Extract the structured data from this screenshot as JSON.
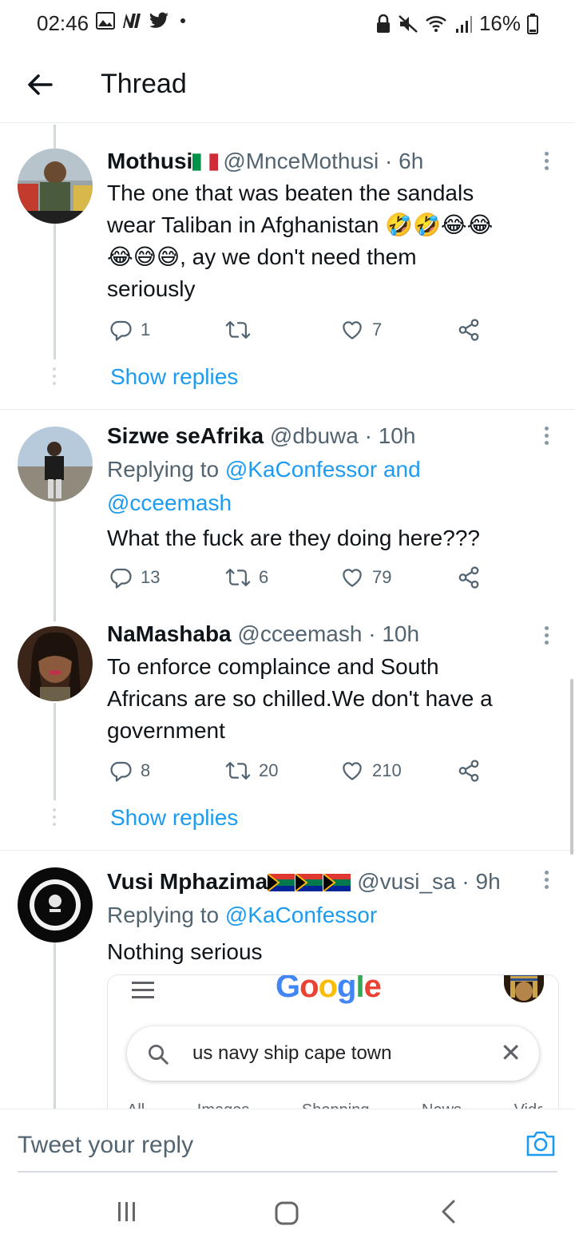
{
  "status_bar": {
    "time": "02:46",
    "battery": "16%"
  },
  "header": {
    "title": "Thread"
  },
  "tweets": [
    {
      "name": "Mothusi",
      "name_flag": "🇮🇹",
      "handle": "@MnceMothusi",
      "time": "· 6h",
      "text_line1": "The one that was beaten the sandals",
      "text_line2": "wear Taliban in Afghanistan 🤣🤣😂😂",
      "text_line3": "😂😅😅, ay we don't need them",
      "text_line4": "seriously",
      "replies": "1",
      "retweets": "",
      "likes": "7",
      "show_replies": "Show replies"
    },
    {
      "name": "Sizwe seAfrika",
      "handle": "@dbuwa",
      "time": "· 10h",
      "replying_prefix": "Replying to ",
      "replying_mention1": "@KaConfessor",
      "replying_and": " and",
      "replying_mention2": "@cceemash",
      "text": "What the fuck are they doing here???",
      "replies": "13",
      "retweets": "6",
      "likes": "79"
    },
    {
      "name": "NaMashaba",
      "handle": "@cceemash",
      "time": "· 10h",
      "text_line1": "To enforce complaince and South",
      "text_line2": "Africans are so chilled.We don't have a",
      "text_line3": "government",
      "replies": "8",
      "retweets": "20",
      "likes": "210",
      "show_replies": "Show replies"
    },
    {
      "name": "Vusi Mphazima",
      "name_flags": "🇿🇦🇿🇦🇿🇦",
      "handle": "@vusi_sa",
      "time": "· 9h",
      "replying_prefix": "Replying to ",
      "replying_mention1": "@KaConfessor",
      "text": "Nothing serious"
    }
  ],
  "embedded_image": {
    "logo": "Google",
    "search_query": "us navy ship cape town",
    "tabs": "All Images Shopping News Videos M"
  },
  "reply_bar": {
    "placeholder": "Tweet your reply"
  },
  "colors": {
    "link": "#1d9bf0",
    "secondary": "#536471",
    "divider": "#e6ecf0"
  },
  "icons": [
    "back-arrow-icon",
    "reply-icon",
    "retweet-icon",
    "like-icon",
    "share-icon",
    "more-icon",
    "camera-icon",
    "search-icon",
    "close-icon"
  ]
}
